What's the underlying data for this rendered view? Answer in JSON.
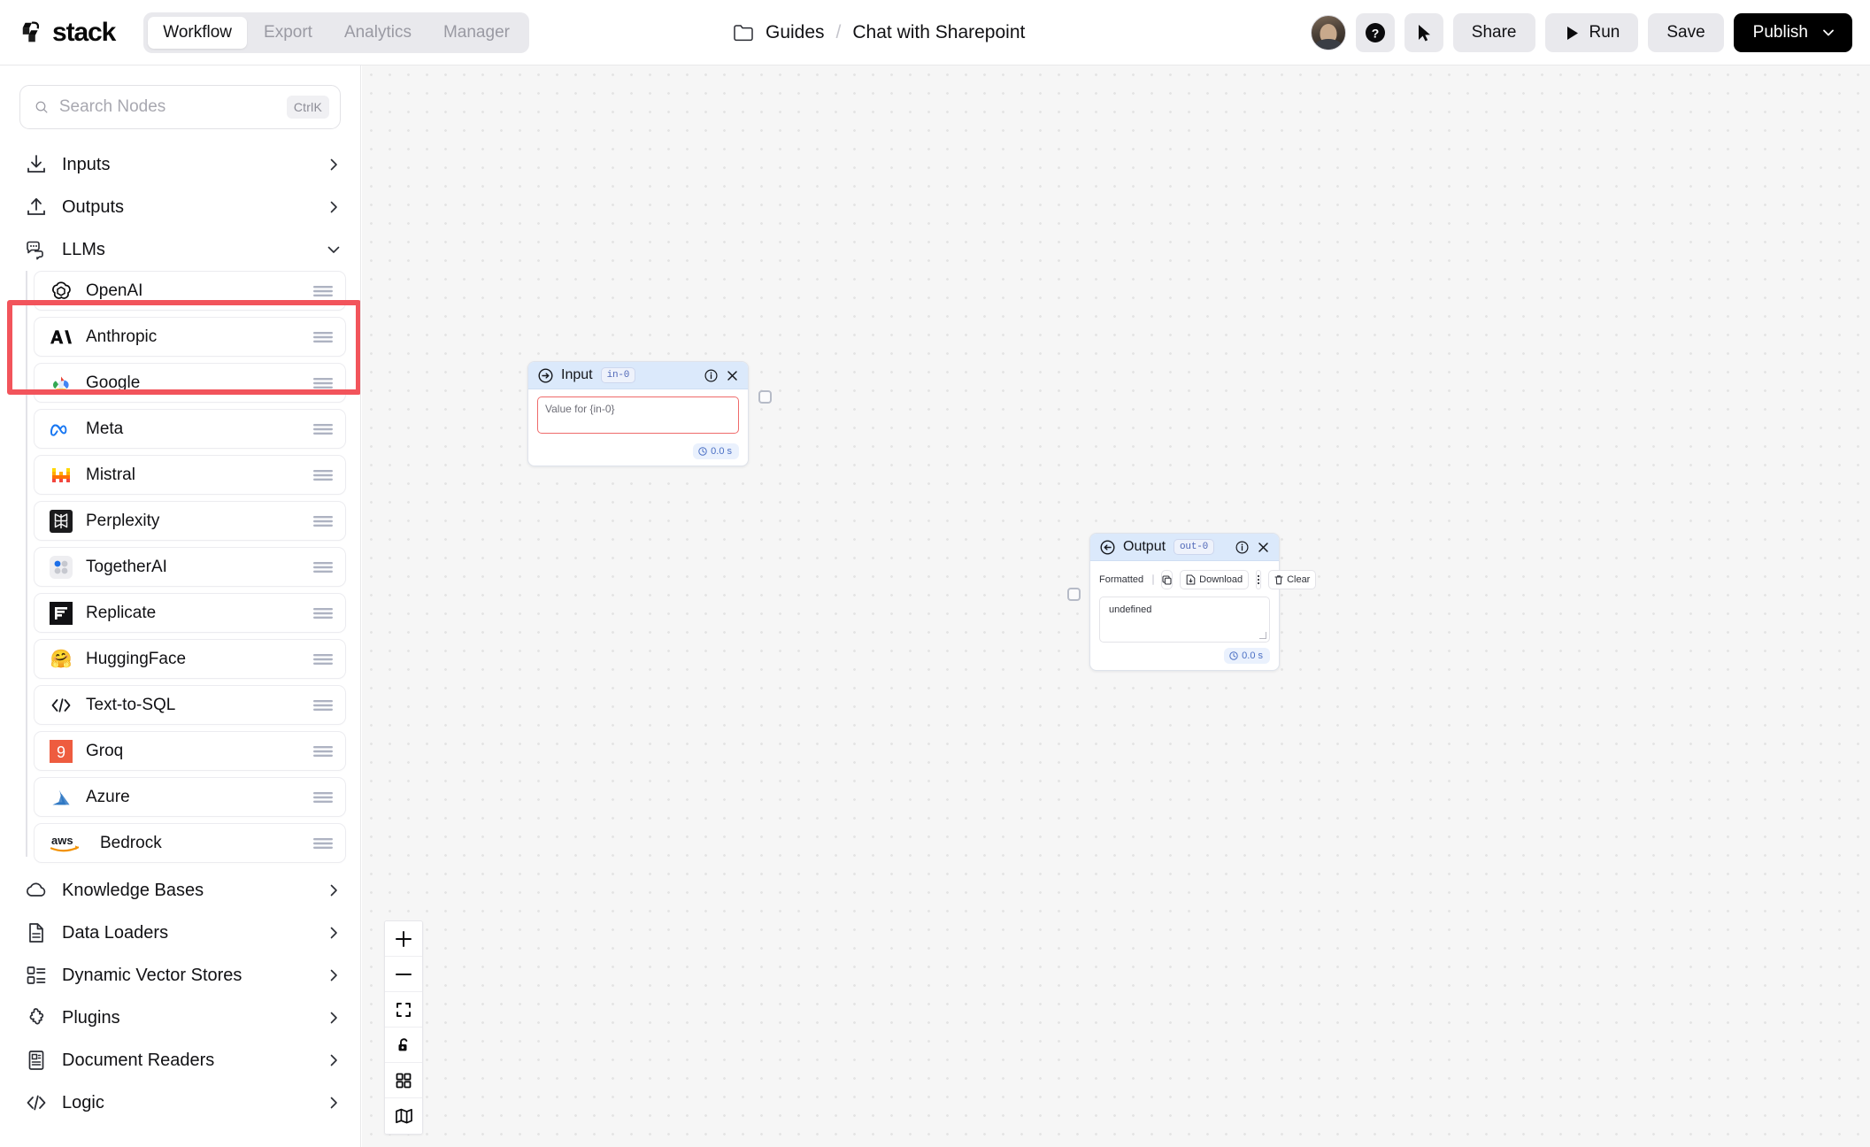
{
  "app": {
    "logo_text": "stack",
    "nav_tabs": [
      {
        "label": "Workflow",
        "active": true
      },
      {
        "label": "Export",
        "active": false
      },
      {
        "label": "Analytics",
        "active": false
      },
      {
        "label": "Manager",
        "active": false
      }
    ]
  },
  "breadcrumb": {
    "folder_icon": "folder-icon",
    "parent": "Guides",
    "separator": "/",
    "current": "Chat with Sharepoint"
  },
  "header_actions": {
    "avatar": "user-avatar",
    "help_label": "?",
    "cursor_icon": "cursor-icon",
    "share_label": "Share",
    "run_label": "Run",
    "save_label": "Save",
    "publish_label": "Publish"
  },
  "sidebar": {
    "search": {
      "placeholder": "Search Nodes",
      "shortcut": "CtrlK",
      "value": ""
    },
    "categories": [
      {
        "label": "Inputs",
        "icon": "download-icon",
        "expanded": false
      },
      {
        "label": "Outputs",
        "icon": "upload-icon",
        "expanded": false
      },
      {
        "label": "LLMs",
        "icon": "chat-bubbles-icon",
        "expanded": true
      },
      {
        "label": "Knowledge Bases",
        "icon": "cloud-icon",
        "expanded": false
      },
      {
        "label": "Data Loaders",
        "icon": "document-icon",
        "expanded": false
      },
      {
        "label": "Dynamic Vector Stores",
        "icon": "list-blocks-icon",
        "expanded": false
      },
      {
        "label": "Plugins",
        "icon": "puzzle-icon",
        "expanded": false
      },
      {
        "label": "Document Readers",
        "icon": "document-reader-icon",
        "expanded": false
      },
      {
        "label": "Logic",
        "icon": "code-brackets-icon",
        "expanded": false
      }
    ],
    "llm_nodes": [
      {
        "label": "OpenAI",
        "icon": "openai-logo",
        "highlighted": true
      },
      {
        "label": "Anthropic",
        "icon": "anthropic-logo"
      },
      {
        "label": "Google",
        "icon": "google-cloud-logo"
      },
      {
        "label": "Meta",
        "icon": "meta-logo"
      },
      {
        "label": "Mistral",
        "icon": "mistral-logo"
      },
      {
        "label": "Perplexity",
        "icon": "perplexity-logo"
      },
      {
        "label": "TogetherAI",
        "icon": "togetherai-logo"
      },
      {
        "label": "Replicate",
        "icon": "replicate-logo"
      },
      {
        "label": "HuggingFace",
        "icon": "huggingface-logo"
      },
      {
        "label": "Text-to-SQL",
        "icon": "code-brackets-icon"
      },
      {
        "label": "Groq",
        "icon": "groq-logo"
      },
      {
        "label": "Azure",
        "icon": "azure-logo"
      },
      {
        "label": "Bedrock",
        "icon": "aws-logo"
      }
    ],
    "highlight_color": "#f2545b"
  },
  "canvas": {
    "nodes": [
      {
        "id": "input",
        "title": "Input",
        "badge": "in-0",
        "back_icon": "arrow-right-circle-icon",
        "info_icon": "info-icon",
        "close_icon": "close-icon",
        "field_placeholder": "Value for {in-0}",
        "field_value": "",
        "timer": "0.0 s",
        "header_color": "#dbe9fb"
      },
      {
        "id": "output",
        "title": "Output",
        "badge": "out-0",
        "back_icon": "arrow-left-circle-icon",
        "info_icon": "info-icon",
        "close_icon": "close-icon",
        "formatted_label": "Formatted",
        "formatted_on": false,
        "copy_label": "copy-icon",
        "download_label": "Download",
        "more_label": "more-vertical-icon",
        "clear_label": "Clear",
        "content": "undefined",
        "timer": "0.0 s",
        "header_color": "#dbe9fb"
      }
    ],
    "controls": [
      {
        "name": "zoom-in",
        "icon": "plus-icon"
      },
      {
        "name": "zoom-out",
        "icon": "minus-icon"
      },
      {
        "name": "fit-view",
        "icon": "fit-screen-icon"
      },
      {
        "name": "lock",
        "icon": "lock-icon"
      },
      {
        "name": "grid",
        "icon": "grid-icon"
      },
      {
        "name": "minimap",
        "icon": "map-icon"
      }
    ]
  }
}
